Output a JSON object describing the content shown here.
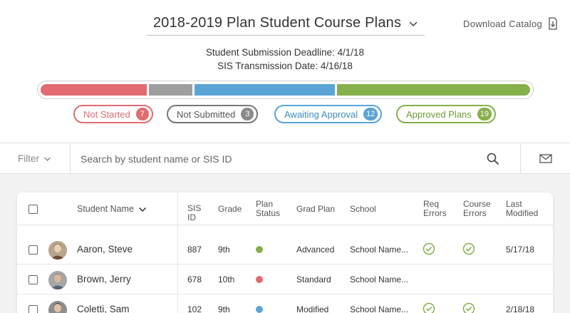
{
  "header": {
    "title": "2018-2019 Plan Student Course Plans",
    "download_label": "Download Catalog",
    "deadline": "Student Submission Deadline: 4/1/18",
    "transmission": "SIS Transmission Date: 4/16/18"
  },
  "progress": {
    "not_started_fraction": 0.22,
    "not_submitted_fraction": 0.09,
    "awaiting_fraction": 0.29,
    "approved_fraction": 0.4
  },
  "status_pills": [
    {
      "label": "Not Started",
      "count": "7",
      "color": "#e36a70"
    },
    {
      "label": "Not Submitted",
      "count": "3",
      "color": "#8a8a8a"
    },
    {
      "label": "Awaiting Approval",
      "count": "12",
      "color": "#5aa4d6"
    },
    {
      "label": "Approved Plans",
      "count": "19",
      "color": "#86b04a"
    }
  ],
  "search": {
    "filter_label": "Filter",
    "placeholder": "Search by student name or SIS ID"
  },
  "table": {
    "columns": {
      "student_name": "Student Name",
      "sis_id_1": "SIS",
      "sis_id_2": "ID",
      "grade": "Grade",
      "plan_status_1": "Plan",
      "plan_status_2": "Status",
      "grad_plan": "Grad Plan",
      "school": "School",
      "req_errors_1": "Req",
      "req_errors_2": "Errors",
      "course_errors_1": "Course",
      "course_errors_2": "Errors",
      "last_modified_1": "Last",
      "last_modified_2": "Modified"
    },
    "rows": [
      {
        "name": "Aaron, Steve",
        "sis_id": "887",
        "grade": "9th",
        "status_color": "#86b04a",
        "grad_plan": "Advanced",
        "school": "School Name...",
        "req_ok": true,
        "course_ok": true,
        "last_modified": "5/17/18"
      },
      {
        "name": "Brown, Jerry",
        "sis_id": "678",
        "grade": "10th",
        "status_color": "#e36a70",
        "grad_plan": "Standard",
        "school": "School Name...",
        "req_ok": false,
        "course_ok": false,
        "last_modified": ""
      },
      {
        "name": "Coletti, Sam",
        "sis_id": "102",
        "grade": "9th",
        "status_color": "#5aa4d6",
        "grad_plan": "Modified",
        "school": "School Name...",
        "req_ok": true,
        "course_ok": true,
        "last_modified": "2/18/18"
      }
    ]
  },
  "colors": {
    "green": "#86b04a",
    "red": "#e36a70",
    "gray": "#9e9e9e",
    "blue": "#5aa4d6"
  },
  "icons": [
    "chevron-down-icon",
    "download-icon",
    "search-icon",
    "mail-icon",
    "checkmark-circle-icon"
  ]
}
